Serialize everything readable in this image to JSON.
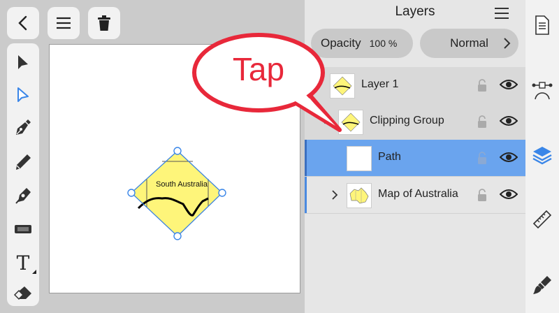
{
  "toolbar_top": {
    "back_icon": "chevron-left-icon",
    "menu_icon": "hamburger-icon",
    "delete_icon": "trash-icon"
  },
  "tools": [
    {
      "name": "move-tool",
      "icon": "arrow-icon"
    },
    {
      "name": "node-tool",
      "icon": "node-arrow-icon",
      "active": true
    },
    {
      "name": "pen-tool",
      "icon": "pen-nib-icon"
    },
    {
      "name": "pencil-tool",
      "icon": "pencil-icon"
    },
    {
      "name": "vector-brush-tool",
      "icon": "brush-icon"
    },
    {
      "name": "fill-tool",
      "icon": "fill-icon"
    },
    {
      "name": "text-tool",
      "icon": "text-icon",
      "label": "T"
    },
    {
      "name": "eraser-tool",
      "icon": "eraser-icon"
    }
  ],
  "canvas": {
    "shape_label": "South Australia",
    "annotation": "Tap"
  },
  "layers_panel": {
    "title": "Layers",
    "opacity_label": "Opacity",
    "opacity_value": "100 %",
    "blend_mode": "Normal",
    "rows": [
      {
        "name": "Layer 1",
        "thumb_label": "South Australia",
        "selected": false
      },
      {
        "name": "Clipping Group",
        "thumb_label": "South Australia",
        "selected": false
      },
      {
        "name": "Path",
        "selected": true
      },
      {
        "name": "Map of Australia",
        "selected": false
      }
    ]
  },
  "right_toolbar": [
    {
      "name": "document-icon"
    },
    {
      "name": "bezier-icon"
    },
    {
      "name": "layers-icon",
      "active": true
    },
    {
      "name": "ruler-icon"
    },
    {
      "name": "paint-brush-icon"
    }
  ],
  "colors": {
    "accent": "#4a8ae0",
    "selected_row": "#6aa4ee",
    "annotation_red": "#e8283a",
    "shape_fill": "#fef57a"
  }
}
